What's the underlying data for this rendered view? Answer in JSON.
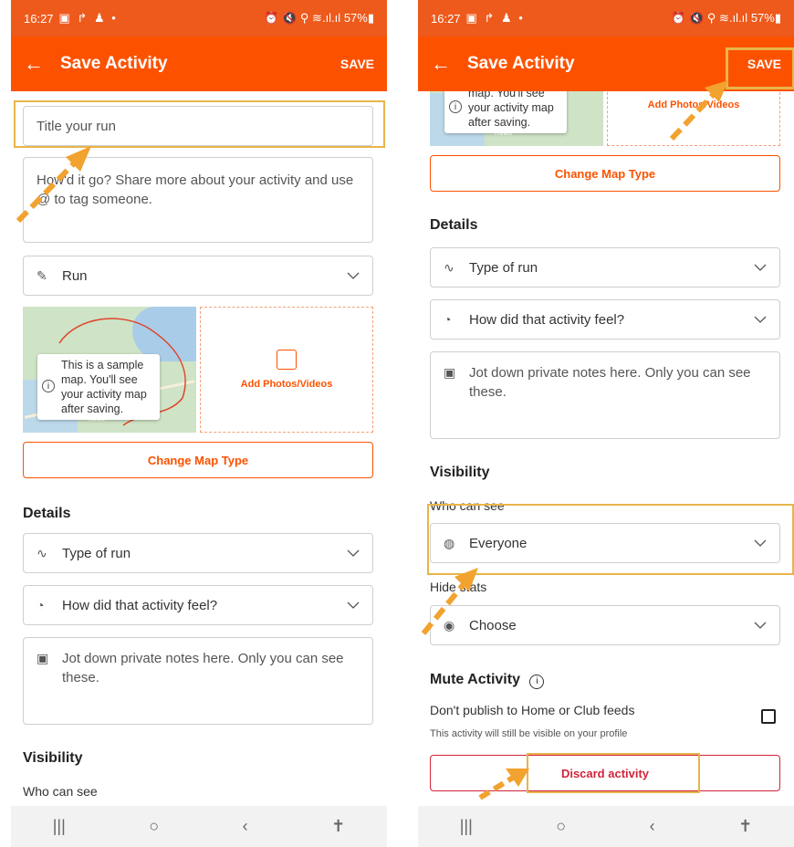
{
  "status_bar": {
    "time": "16:27",
    "left_icons": "▣ ↱ ♟ •",
    "right_icons": "⏰ 🔇 ⚲ ≋.ıl.ıl",
    "battery": "57%▮"
  },
  "app_bar": {
    "back_icon": "arrow-left-icon",
    "title": "Save Activity",
    "save_label": "SAVE"
  },
  "left": {
    "title_placeholder": "Title your run",
    "description_placeholder": "How'd it go? Share more about your activity and use @ to tag someone.",
    "sport": "Run",
    "map_tooltip": "This is a sample map. You'll see your activity map after saving.",
    "add_photos": "Add Photos/Videos",
    "change_map": "Change Map Type",
    "details_heading": "Details",
    "type_of_run": "Type of run",
    "feel": "How did that activity feel?",
    "notes": "Jot down private notes here. Only you can see these.",
    "visibility_heading": "Visibility",
    "who_can_see": "Who can see"
  },
  "right": {
    "map_tooltip": "map. You'll see your activity map after saving.",
    "add_photos": "Add Photos/Videos",
    "change_map": "Change Map Type",
    "details_heading": "Details",
    "type_of_run": "Type of run",
    "feel": "How did that activity feel?",
    "notes": "Jot down private notes here. Only you can see these.",
    "visibility_heading": "Visibility",
    "who_can_see": "Who can see",
    "visibility_value": "Everyone",
    "hide_stats": "Hide stats",
    "hide_stats_value": "Choose",
    "mute_heading": "Mute Activity",
    "dont_publish": "Don't publish to Home or Club feeds",
    "still_visible": "This activity will still be visible on your profile",
    "discard": "Discard activity"
  },
  "map_label": "TruNoo",
  "nav_bar": {
    "recents": "|||",
    "home": "○",
    "back": "‹",
    "accessibility": "✝"
  },
  "colors": {
    "brand": "#fc5200",
    "status_bar": "#ee5a1c",
    "highlight": "#e8b54a",
    "discard": "#d1243a"
  }
}
